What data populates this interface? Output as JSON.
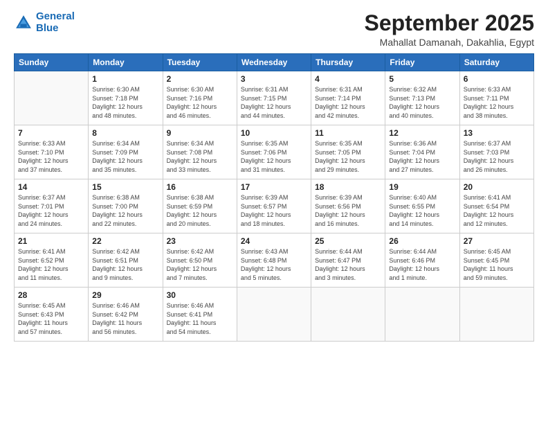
{
  "header": {
    "logo_line1": "General",
    "logo_line2": "Blue",
    "month": "September 2025",
    "location": "Mahallat Damanah, Dakahlia, Egypt"
  },
  "weekdays": [
    "Sunday",
    "Monday",
    "Tuesday",
    "Wednesday",
    "Thursday",
    "Friday",
    "Saturday"
  ],
  "weeks": [
    [
      {
        "day": "",
        "info": ""
      },
      {
        "day": "1",
        "info": "Sunrise: 6:30 AM\nSunset: 7:18 PM\nDaylight: 12 hours\nand 48 minutes."
      },
      {
        "day": "2",
        "info": "Sunrise: 6:30 AM\nSunset: 7:16 PM\nDaylight: 12 hours\nand 46 minutes."
      },
      {
        "day": "3",
        "info": "Sunrise: 6:31 AM\nSunset: 7:15 PM\nDaylight: 12 hours\nand 44 minutes."
      },
      {
        "day": "4",
        "info": "Sunrise: 6:31 AM\nSunset: 7:14 PM\nDaylight: 12 hours\nand 42 minutes."
      },
      {
        "day": "5",
        "info": "Sunrise: 6:32 AM\nSunset: 7:13 PM\nDaylight: 12 hours\nand 40 minutes."
      },
      {
        "day": "6",
        "info": "Sunrise: 6:33 AM\nSunset: 7:11 PM\nDaylight: 12 hours\nand 38 minutes."
      }
    ],
    [
      {
        "day": "7",
        "info": "Sunrise: 6:33 AM\nSunset: 7:10 PM\nDaylight: 12 hours\nand 37 minutes."
      },
      {
        "day": "8",
        "info": "Sunrise: 6:34 AM\nSunset: 7:09 PM\nDaylight: 12 hours\nand 35 minutes."
      },
      {
        "day": "9",
        "info": "Sunrise: 6:34 AM\nSunset: 7:08 PM\nDaylight: 12 hours\nand 33 minutes."
      },
      {
        "day": "10",
        "info": "Sunrise: 6:35 AM\nSunset: 7:06 PM\nDaylight: 12 hours\nand 31 minutes."
      },
      {
        "day": "11",
        "info": "Sunrise: 6:35 AM\nSunset: 7:05 PM\nDaylight: 12 hours\nand 29 minutes."
      },
      {
        "day": "12",
        "info": "Sunrise: 6:36 AM\nSunset: 7:04 PM\nDaylight: 12 hours\nand 27 minutes."
      },
      {
        "day": "13",
        "info": "Sunrise: 6:37 AM\nSunset: 7:03 PM\nDaylight: 12 hours\nand 26 minutes."
      }
    ],
    [
      {
        "day": "14",
        "info": "Sunrise: 6:37 AM\nSunset: 7:01 PM\nDaylight: 12 hours\nand 24 minutes."
      },
      {
        "day": "15",
        "info": "Sunrise: 6:38 AM\nSunset: 7:00 PM\nDaylight: 12 hours\nand 22 minutes."
      },
      {
        "day": "16",
        "info": "Sunrise: 6:38 AM\nSunset: 6:59 PM\nDaylight: 12 hours\nand 20 minutes."
      },
      {
        "day": "17",
        "info": "Sunrise: 6:39 AM\nSunset: 6:57 PM\nDaylight: 12 hours\nand 18 minutes."
      },
      {
        "day": "18",
        "info": "Sunrise: 6:39 AM\nSunset: 6:56 PM\nDaylight: 12 hours\nand 16 minutes."
      },
      {
        "day": "19",
        "info": "Sunrise: 6:40 AM\nSunset: 6:55 PM\nDaylight: 12 hours\nand 14 minutes."
      },
      {
        "day": "20",
        "info": "Sunrise: 6:41 AM\nSunset: 6:54 PM\nDaylight: 12 hours\nand 12 minutes."
      }
    ],
    [
      {
        "day": "21",
        "info": "Sunrise: 6:41 AM\nSunset: 6:52 PM\nDaylight: 12 hours\nand 11 minutes."
      },
      {
        "day": "22",
        "info": "Sunrise: 6:42 AM\nSunset: 6:51 PM\nDaylight: 12 hours\nand 9 minutes."
      },
      {
        "day": "23",
        "info": "Sunrise: 6:42 AM\nSunset: 6:50 PM\nDaylight: 12 hours\nand 7 minutes."
      },
      {
        "day": "24",
        "info": "Sunrise: 6:43 AM\nSunset: 6:48 PM\nDaylight: 12 hours\nand 5 minutes."
      },
      {
        "day": "25",
        "info": "Sunrise: 6:44 AM\nSunset: 6:47 PM\nDaylight: 12 hours\nand 3 minutes."
      },
      {
        "day": "26",
        "info": "Sunrise: 6:44 AM\nSunset: 6:46 PM\nDaylight: 12 hours\nand 1 minute."
      },
      {
        "day": "27",
        "info": "Sunrise: 6:45 AM\nSunset: 6:45 PM\nDaylight: 11 hours\nand 59 minutes."
      }
    ],
    [
      {
        "day": "28",
        "info": "Sunrise: 6:45 AM\nSunset: 6:43 PM\nDaylight: 11 hours\nand 57 minutes."
      },
      {
        "day": "29",
        "info": "Sunrise: 6:46 AM\nSunset: 6:42 PM\nDaylight: 11 hours\nand 56 minutes."
      },
      {
        "day": "30",
        "info": "Sunrise: 6:46 AM\nSunset: 6:41 PM\nDaylight: 11 hours\nand 54 minutes."
      },
      {
        "day": "",
        "info": ""
      },
      {
        "day": "",
        "info": ""
      },
      {
        "day": "",
        "info": ""
      },
      {
        "day": "",
        "info": ""
      }
    ]
  ]
}
